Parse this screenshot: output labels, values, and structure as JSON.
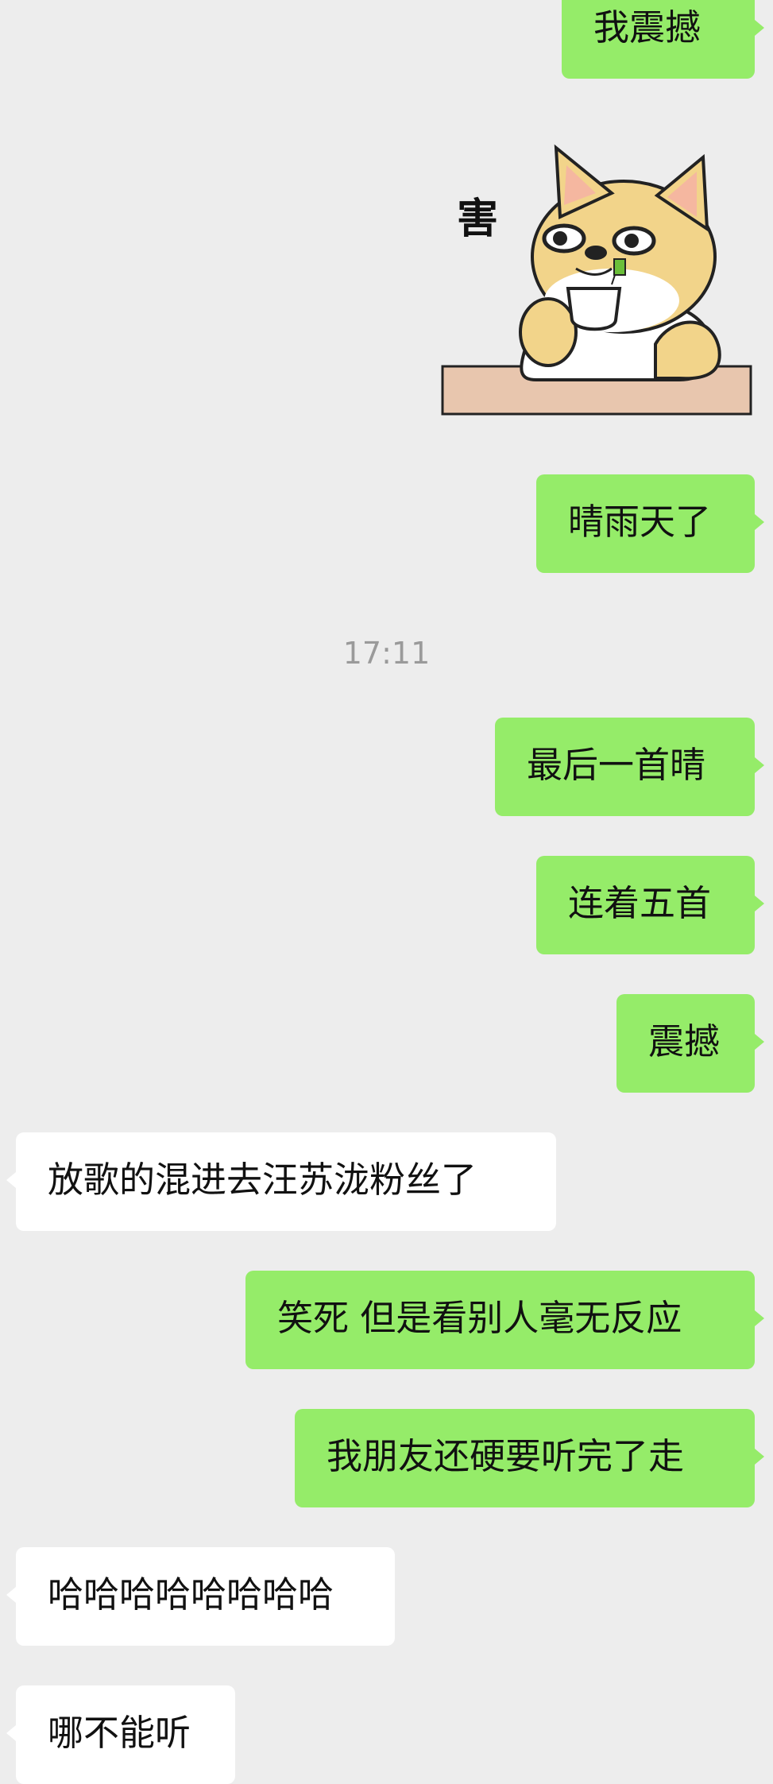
{
  "messages": [
    {
      "sender": "me",
      "text": "我震撼"
    },
    {
      "sender": "me",
      "type": "sticker",
      "sticker": {
        "caption": "害",
        "icon": "shiba-dog-drinking-tea"
      }
    },
    {
      "sender": "me",
      "text": "晴雨天了"
    },
    {
      "timestamp": "17:11"
    },
    {
      "sender": "me",
      "text": "最后一首晴"
    },
    {
      "sender": "me",
      "text": "连着五首"
    },
    {
      "sender": "me",
      "text": "震撼"
    },
    {
      "sender": "them",
      "text": "放歌的混进去汪苏泷粉丝了"
    },
    {
      "sender": "me",
      "text": "笑死 但是看别人毫无反应"
    },
    {
      "sender": "me",
      "text": "我朋友还硬要听完了走"
    },
    {
      "sender": "them",
      "text": "哈哈哈哈哈哈哈哈"
    },
    {
      "sender": "them",
      "text": "哪不能听"
    }
  ],
  "colors": {
    "background": "#ededed",
    "my_bubble": "#95ec69",
    "their_bubble": "#ffffff",
    "timestamp": "#9a9a9a"
  }
}
